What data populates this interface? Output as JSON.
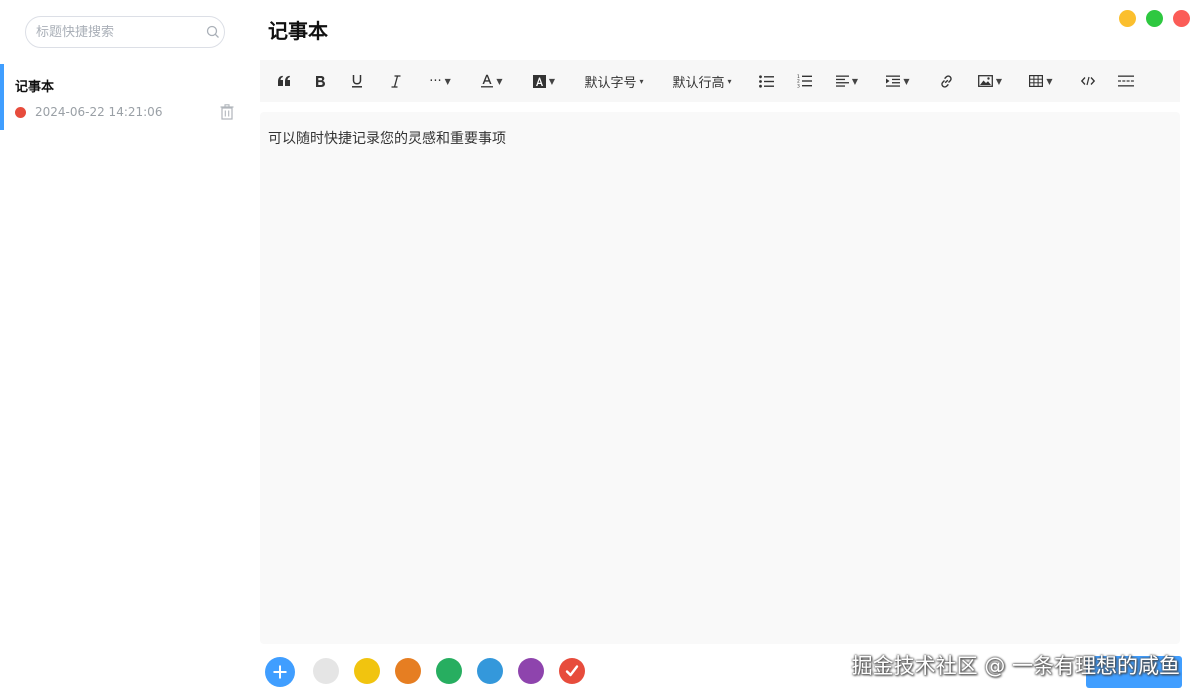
{
  "sidebar": {
    "search": {
      "placeholder": "标题快捷搜索",
      "value": ""
    },
    "notes": [
      {
        "title": "记事本",
        "date": "2024-06-22 14:21:06",
        "color": "#e74c3c",
        "active": true
      }
    ]
  },
  "main": {
    "title": "记事本",
    "window_controls": {
      "minimize_color": "#fbbf2e",
      "maximize_color": "#2ec840",
      "close_color": "#fb5c57"
    },
    "toolbar": {
      "font_size_label": "默认字号",
      "line_height_label": "默认行高",
      "more_label": "···"
    },
    "editor": {
      "content": "可以随时快捷记录您的灵感和重要事项"
    },
    "colors": [
      "#e5e5e5",
      "#f1c40f",
      "#e67e22",
      "#27ae60",
      "#3498db",
      "#8e44ad",
      "#e74c3c"
    ],
    "selected_color": "#e74c3c",
    "watermark": "掘金技术社区 @ 一条有理想的咸鱼"
  },
  "accent": "#409eff"
}
